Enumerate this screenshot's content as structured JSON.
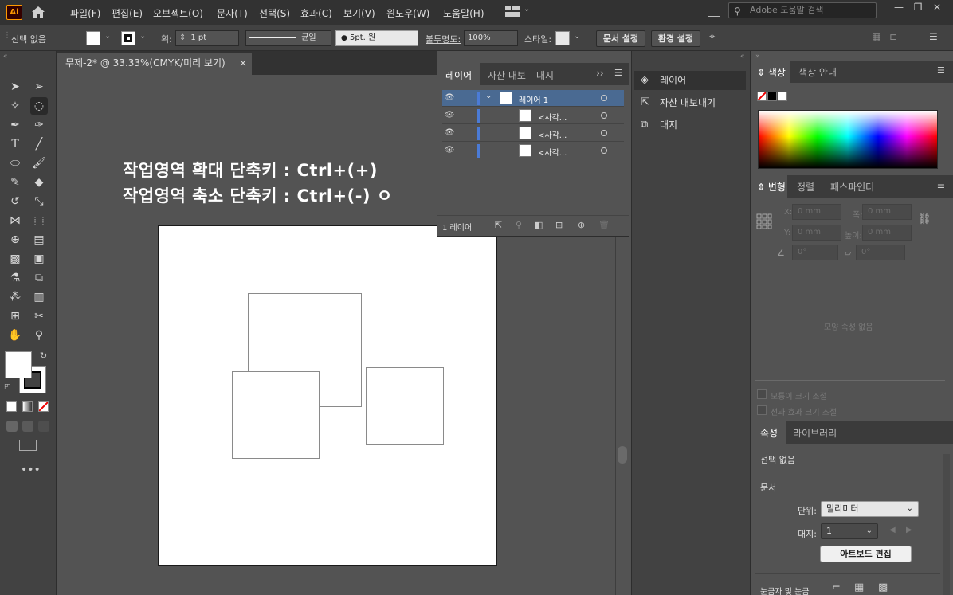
{
  "app": {
    "logo_text": "Ai",
    "menu": [
      "파일(F)",
      "편집(E)",
      "오브젝트(O)",
      "문자(T)",
      "선택(S)",
      "효과(C)",
      "보기(V)",
      "윈도우(W)",
      "도움말(H)"
    ],
    "search_placeholder": "Adobe 도움말 검색"
  },
  "control_bar": {
    "selection_label": "선택 없음",
    "stroke_label": "획:",
    "stroke_value": "1 pt",
    "stroke_style": "균일",
    "brush_value": "5pt. 원",
    "opacity_label": "불투명도:",
    "opacity_value": "100%",
    "style_label": "스타일:",
    "doc_setup_button": "문서 설정",
    "preferences_button": "환경 설정"
  },
  "document": {
    "tab_title": "무제-2* @ 33.33%(CMYK/미리 보기)",
    "close_glyph": "×",
    "overlay_line1": "작업영역 확대 단축키 : Ctrl+(+)",
    "overlay_line2": "작업영역 축소 단축키 : Ctrl+(-) ㅇ"
  },
  "layers_panel": {
    "tabs": [
      "레이어",
      "자산 내보",
      "대지"
    ],
    "rows": [
      {
        "name": "레이어 1",
        "selected": true
      },
      {
        "name": "<사각...",
        "selected": false
      },
      {
        "name": "<사각...",
        "selected": false
      },
      {
        "name": "<사각...",
        "selected": false
      }
    ],
    "footer_count": "1 레이어"
  },
  "side_list": {
    "items": [
      "레이어",
      "자산 내보내기",
      "대지"
    ]
  },
  "color_panel": {
    "tabs": [
      "색상",
      "색상 안내"
    ]
  },
  "transform_panel": {
    "tabs": [
      "변형",
      "정렬",
      "패스파인더"
    ],
    "x_label": "X:",
    "x_value": "0 mm",
    "w_label": "폭:",
    "w_value": "0 mm",
    "y_label": "Y:",
    "y_value": "0 mm",
    "h_label": "높이:",
    "h_value": "0 mm",
    "angle_value": "0°",
    "shear_value": "0°",
    "no_shape_text": "모양 속성 없음",
    "scale_corners": "모퉁이 크기 조절",
    "scale_effects": "선과 효과 크기 조절"
  },
  "properties_panel": {
    "tabs": [
      "속성",
      "라이브러리"
    ],
    "selection": "선택 없음",
    "section_document": "문서",
    "units_label": "단위:",
    "units_value": "밀리미터",
    "artboard_label": "대지:",
    "artboard_value": "1",
    "edit_artboard_button": "아트보드 편집",
    "rulers_label": "눈금자 및 눈금"
  },
  "colors": {
    "layer_selected": "#4a6a92",
    "layer_bar": "#4b7bd6",
    "logo_accent": "#ff9a00"
  }
}
